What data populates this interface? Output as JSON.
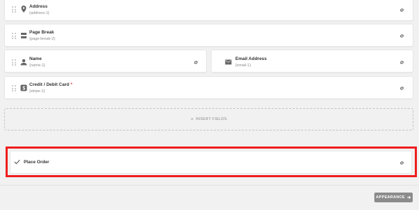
{
  "fields": [
    {
      "title": "Address",
      "slug": "{address-1}",
      "icon": "location-pin-icon"
    },
    {
      "title": "Page Break",
      "slug": "{page-break-2}",
      "icon": "page-break-icon"
    },
    {
      "title": "Name",
      "slug": "{name-1}",
      "icon": "user-icon"
    },
    {
      "title": "Email Address",
      "slug": "{email-1}",
      "icon": "envelope-icon"
    },
    {
      "title": "Credit / Debit Card",
      "slug": "{stripe-1}",
      "icon": "stripe-icon",
      "required": "*"
    }
  ],
  "insert_fields": {
    "plus": "+",
    "label": "INSERT FIELDS"
  },
  "submit": {
    "icon": "checkmark-icon",
    "label": "Place Order"
  },
  "footer": {
    "appearance_label": "APPEARANCE",
    "arrow": "➔"
  },
  "colors": {
    "highlight": "#ee1d1d",
    "required": "#e0403a",
    "button": "#8b8b8b"
  }
}
